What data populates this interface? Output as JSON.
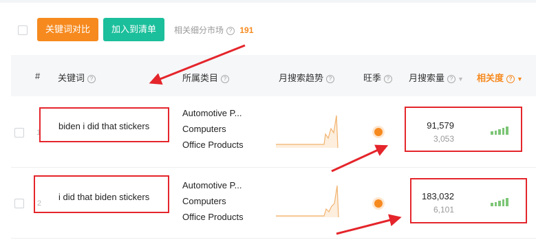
{
  "toolbar": {
    "compare_label": "关键词对比",
    "add_list_label": "加入到清单",
    "market_label": "相关细分市场",
    "market_count": "191"
  },
  "table": {
    "headers": {
      "index": "#",
      "keyword": "关键词",
      "category": "所属类目",
      "trend": "月搜索趋势",
      "season": "旺季",
      "volume": "月搜索量",
      "relevance": "相关度"
    },
    "rows": [
      {
        "index": "1",
        "keyword": "biden i did that stickers",
        "categories": [
          "Automotive P...",
          "Computers",
          "Office Products"
        ],
        "volume": "91,579",
        "volume_sub": "3,053",
        "relevance_level": 5
      },
      {
        "index": "2",
        "keyword": "i did that biden stickers",
        "categories": [
          "Automotive P...",
          "Computers",
          "Office Products"
        ],
        "volume": "183,032",
        "volume_sub": "6,101",
        "relevance_level": 5
      }
    ]
  },
  "colors": {
    "accent_orange": "#f68a1f",
    "accent_teal": "#1bbf9b",
    "highlight_red": "#e4252b",
    "relevance_green": "#7cc576"
  }
}
